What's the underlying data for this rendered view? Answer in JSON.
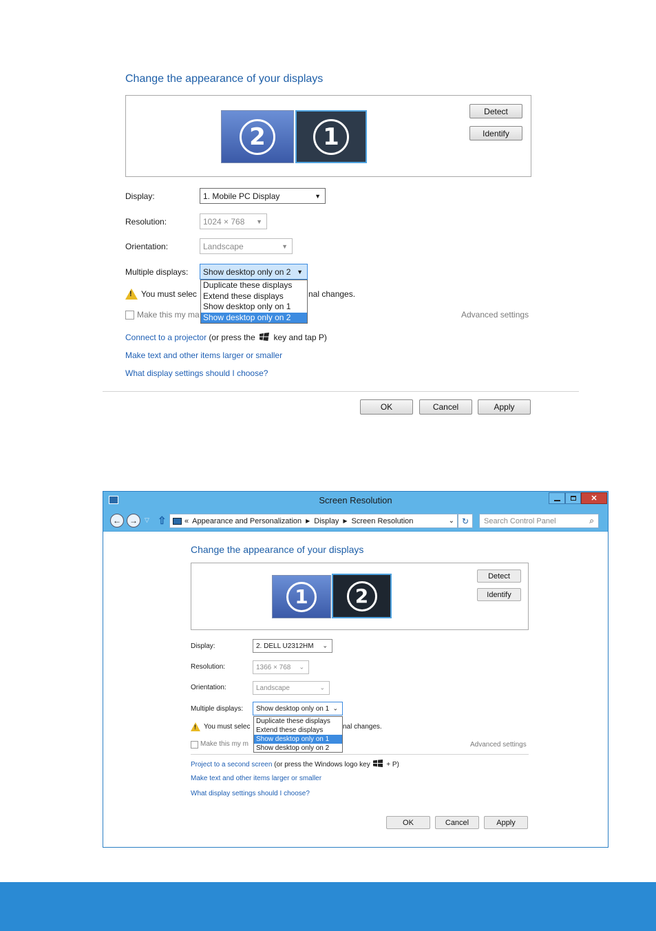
{
  "top": {
    "heading": "Change the appearance of your displays",
    "monitors": [
      {
        "label": "2",
        "color": "#4a6fbf"
      },
      {
        "label": "1",
        "color": "#2d3a4a"
      }
    ],
    "detect_label": "Detect",
    "identify_label": "Identify",
    "display_label": "Display:",
    "display_value": "1. Mobile PC Display",
    "resolution_label": "Resolution:",
    "resolution_value": "1024 × 768",
    "orientation_label": "Orientation:",
    "orientation_value": "Landscape",
    "multiple_label": "Multiple displays:",
    "multiple_value": "Show desktop only on 2",
    "dropdown_options": [
      "Duplicate these displays",
      "Extend these displays",
      "Show desktop only on 1",
      "Show desktop only on 2"
    ],
    "warning_left": "You must selec",
    "warning_right": "nal changes.",
    "checkbox_label": "Make this my ma",
    "advanced_settings": "Advanced settings",
    "link1_link": "Connect to a projector",
    "link1_rest_a": "(or press the",
    "link1_rest_b": "key and tap P)",
    "link2": "Make text and other items larger or smaller",
    "link3": "What display settings should I choose?",
    "ok_label": "OK",
    "cancel_label": "Cancel",
    "apply_label": "Apply"
  },
  "bottom": {
    "window_title": "Screen Resolution",
    "breadcrumb_prefix": "«",
    "breadcrumb": [
      "Appearance and Personalization",
      "Display",
      "Screen Resolution"
    ],
    "search_placeholder": "Search Control Panel",
    "heading": "Change the appearance of your displays",
    "monitors": [
      {
        "label": "1",
        "color": "#4a6fbf"
      },
      {
        "label": "2",
        "color": "#1e2630"
      }
    ],
    "detect_label": "Detect",
    "identify_label": "Identify",
    "display_label": "Display:",
    "display_value": "2. DELL U2312HM",
    "resolution_label": "Resolution:",
    "resolution_value": "1366 × 768",
    "orientation_label": "Orientation:",
    "orientation_value": "Landscape",
    "multiple_label": "Multiple displays:",
    "multiple_value": "Show desktop only on 1",
    "dropdown_options": [
      "Duplicate these displays",
      "Extend these displays",
      "Show desktop only on 1",
      "Show desktop only on 2"
    ],
    "warning_left": "You must selec",
    "warning_right": "nal changes.",
    "checkbox_label": "Make this my m",
    "advanced_settings": "Advanced settings",
    "link1_link": "Project to a second screen",
    "link1_rest_a": "(or press the Windows logo key",
    "link1_rest_b": "+ P)",
    "link2": "Make text and other items larger or smaller",
    "link3": "What display settings should I choose?",
    "ok_label": "OK",
    "cancel_label": "Cancel",
    "apply_label": "Apply"
  },
  "colors": {
    "link": "#1e5fb4",
    "selection": "#3c8be0",
    "titlebar": "#5fb4e8",
    "close": "#c7453a",
    "footer_band": "#2a8ad4"
  }
}
